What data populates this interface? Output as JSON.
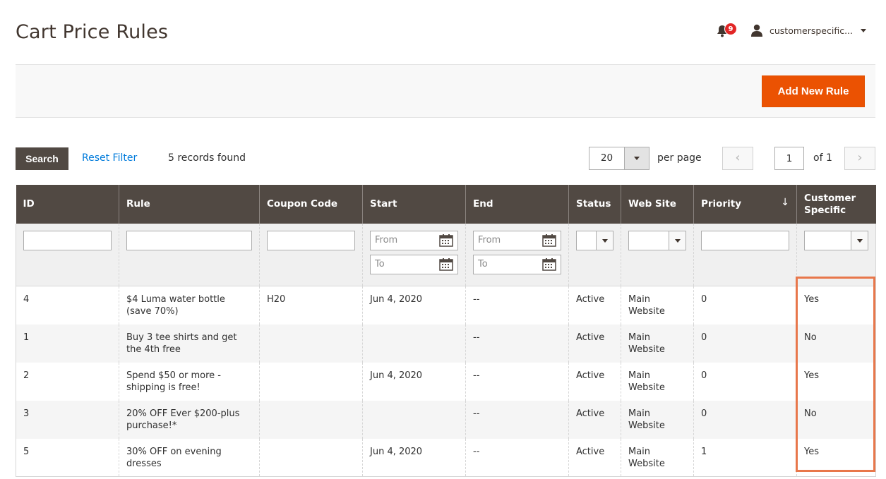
{
  "page_title": "Cart Price Rules",
  "header": {
    "notifications_count": "9",
    "username": "customerspecific..."
  },
  "actions": {
    "add_new_rule": "Add New Rule"
  },
  "toolbar": {
    "search_label": "Search",
    "reset_filter_label": "Reset Filter",
    "records_found": "5 records found",
    "per_page_value": "20",
    "per_page_label": "per page",
    "page_current": "1",
    "page_of": "of 1"
  },
  "columns": [
    "ID",
    "Rule",
    "Coupon Code",
    "Start",
    "End",
    "Status",
    "Web Site",
    "Priority",
    "Customer Specific"
  ],
  "sort_indicator": "↓",
  "filters": {
    "from_placeholder": "From",
    "to_placeholder": "To"
  },
  "rows": [
    {
      "id": "4",
      "rule": "$4 Luma water bottle (save 70%)",
      "coupon": "H20",
      "start": "Jun 4, 2020",
      "end": "--",
      "status": "Active",
      "website": "Main Website",
      "priority": "0",
      "customer_specific": "Yes"
    },
    {
      "id": "1",
      "rule": "Buy 3 tee shirts and get the 4th free",
      "coupon": "",
      "start": "",
      "end": "--",
      "status": "Active",
      "website": "Main Website",
      "priority": "0",
      "customer_specific": "No"
    },
    {
      "id": "2",
      "rule": "Spend $50 or more - shipping is free!",
      "coupon": "",
      "start": "Jun 4, 2020",
      "end": "--",
      "status": "Active",
      "website": "Main Website",
      "priority": "0",
      "customer_specific": "Yes"
    },
    {
      "id": "3",
      "rule": "20% OFF Ever $200-plus purchase!*",
      "coupon": "",
      "start": "",
      "end": "--",
      "status": "Active",
      "website": "Main Website",
      "priority": "0",
      "customer_specific": "No"
    },
    {
      "id": "5",
      "rule": "30% OFF on evening dresses",
      "coupon": "",
      "start": "Jun 4, 2020",
      "end": "--",
      "status": "Active",
      "website": "Main Website",
      "priority": "1",
      "customer_specific": "Yes"
    }
  ],
  "colors": {
    "accent": "#eb5202",
    "header_bg": "#514943",
    "link": "#007bdb",
    "highlight": "#e8774b"
  }
}
